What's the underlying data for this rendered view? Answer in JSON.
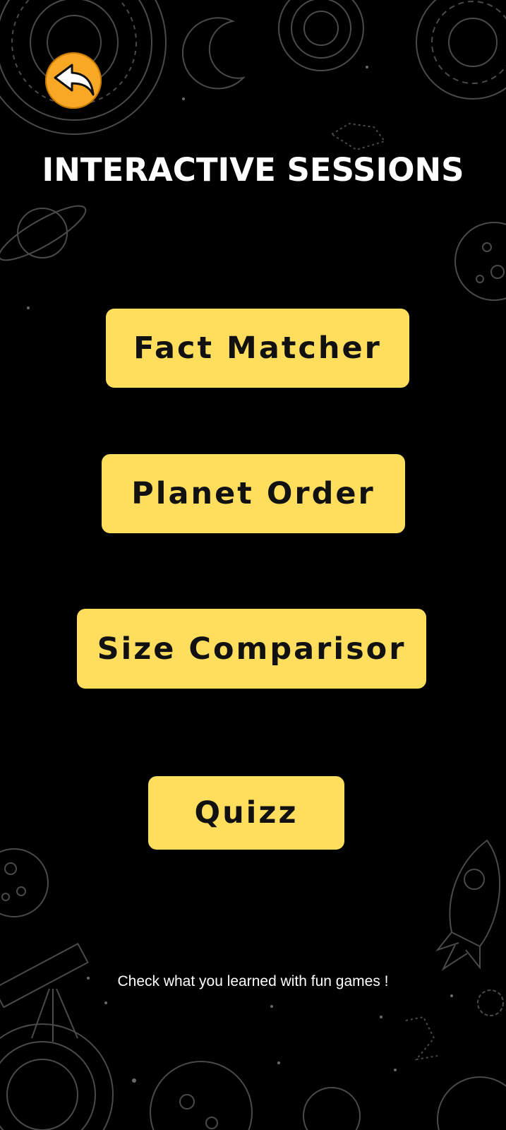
{
  "header": {
    "title": "INTERACTIVE SESSIONS"
  },
  "nav": {
    "back_icon": "back-arrow-icon"
  },
  "menu": {
    "items": [
      {
        "label": "Fact Matcher"
      },
      {
        "label": "Planet Order"
      },
      {
        "label": "Size Comparisor"
      },
      {
        "label": "Quizz"
      }
    ]
  },
  "footer": {
    "caption": "Check what you learned with fun games !"
  },
  "colors": {
    "background": "#000000",
    "button": "#ffde5e",
    "back_button": "#f9a825",
    "text_light": "#ffffff",
    "doodle": "#5a5a5a"
  }
}
